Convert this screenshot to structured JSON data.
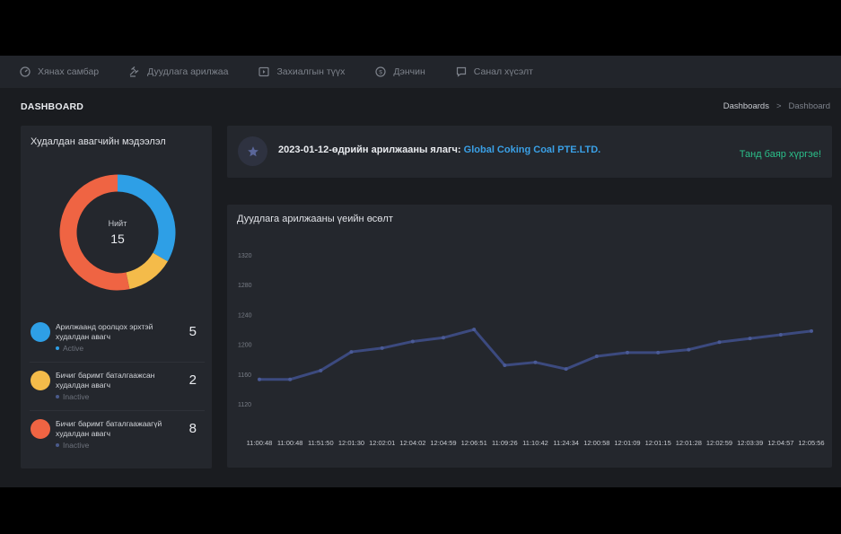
{
  "nav": {
    "items": [
      {
        "label": "Хянах самбар",
        "icon": "dashboard-icon"
      },
      {
        "label": "Дуудлага арилжаа",
        "icon": "gavel-icon"
      },
      {
        "label": "Захиалгын түүх",
        "icon": "history-icon"
      },
      {
        "label": "Дэнчин",
        "icon": "coin-icon"
      },
      {
        "label": "Санал хүсэлт",
        "icon": "feedback-icon"
      }
    ]
  },
  "page": {
    "title": "DASHBOARD",
    "breadcrumb": {
      "root": "Dashboards",
      "separator": ">",
      "current": "Dashboard"
    }
  },
  "supplier_info": {
    "title": "Худалдан авагчийн мэдээлэл",
    "total_label": "Нийт",
    "total": "15",
    "items": [
      {
        "label": "Арилжаанд оролцох эрхтэй худалдан авагч",
        "status": "Active",
        "count": "5",
        "color": "#2e9fe6",
        "status_color": "#2e9fe6"
      },
      {
        "label": "Бичиг баримт баталгаажсан худалдан авагч",
        "status": "Inactive",
        "count": "2",
        "color": "#f4bb4a",
        "status_color": "#4a5a8a"
      },
      {
        "label": "Бичиг баримт баталгаажаагүй худалдан авагч",
        "status": "Inactive",
        "count": "8",
        "color": "#ef6443",
        "status_color": "#4a5a8a"
      }
    ]
  },
  "banner": {
    "icon": "star-icon",
    "text": "2023-01-12-өдрийн арилжааны ялагч:",
    "company": "Global Coking Coal PTE.LTD.",
    "congrats": "Танд баяр хүргэе!"
  },
  "chart_data": {
    "type": "line",
    "title": "Дуудлага арилжааны үеийн өсөлт",
    "x": [
      "11:00:48",
      "11:00:48",
      "11:51:50",
      "12:01:30",
      "12:02:01",
      "12:04:02",
      "12:04:59",
      "12:06:51",
      "11:09:26",
      "11:10:42",
      "11:24:34",
      "12:00:58",
      "12:01:09",
      "12:01:15",
      "12:01:28",
      "12:02:59",
      "12:03:39",
      "12:04:57",
      "12:05:56"
    ],
    "series": [
      {
        "values": [
          1154,
          1154,
          1166,
          1191,
          1196,
          1205,
          1210,
          1221,
          1173,
          1177,
          1168,
          1185,
          1190,
          1190,
          1194,
          1204,
          1209,
          1214,
          1219
        ]
      }
    ],
    "yticks": [
      1120,
      1160,
      1200,
      1240,
      1280,
      1320
    ],
    "ylim": [
      1120,
      1320
    ],
    "line_color": "#3c4a7f",
    "grid": false
  }
}
